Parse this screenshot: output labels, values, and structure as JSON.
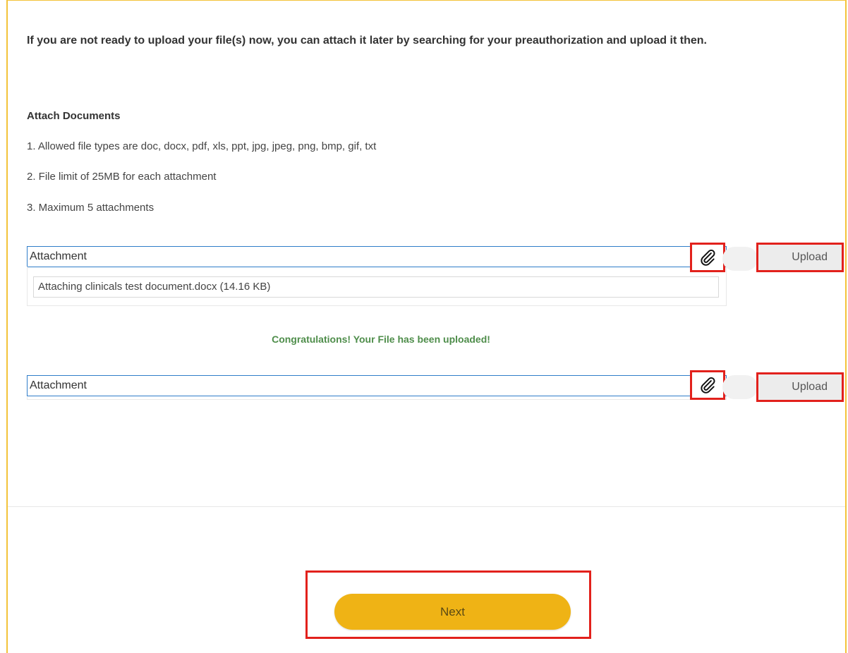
{
  "intro_text": "If you are not ready to upload your file(s) now, you can attach it later by searching for your preauthorization and upload it then.",
  "attach_section": {
    "title": "Attach Documents",
    "rules": [
      "1. Allowed file types are doc, docx, pdf, xls, ppt, jpg, jpeg, png, bmp, gif, txt",
      "2. File limit of 25MB for each attachment",
      "3. Maximum 5 attachments"
    ]
  },
  "attachments": [
    {
      "value": "Attachment",
      "upload_label": "Upload",
      "attached_file": "Attaching clinicals test document.docx (14.16 KB)"
    },
    {
      "value": "Attachment",
      "upload_label": "Upload"
    }
  ],
  "success_message": "Congratulations! Your File has been uploaded!",
  "next_label": "Next",
  "icons": {
    "attach": "paperclip-icon"
  },
  "colors": {
    "accent": "#efb315",
    "highlight": "#e2211c",
    "success": "#4e8d4a",
    "field_border": "#2f7dc9"
  }
}
